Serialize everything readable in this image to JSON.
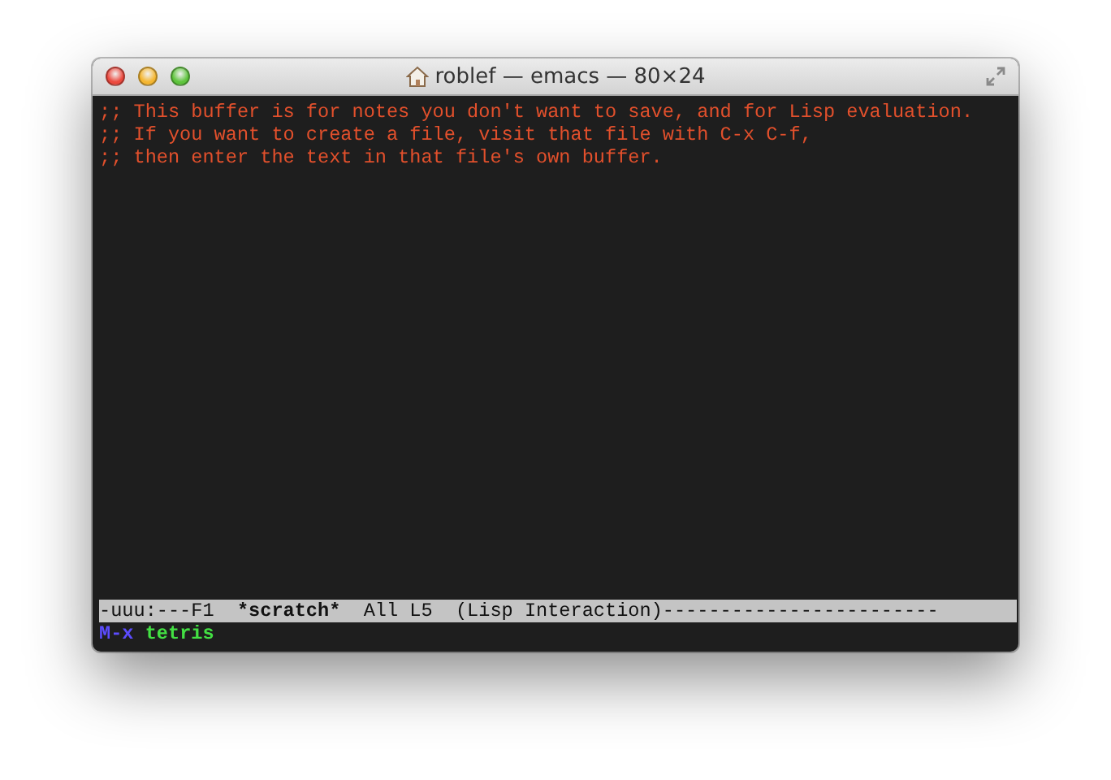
{
  "window": {
    "title": "roblef — emacs — 80×24"
  },
  "buffer_lines": [
    ";; This buffer is for notes you don't want to save, and for Lisp evaluation.",
    ";; If you want to create a file, visit that file with C-x C-f,",
    ";; then enter the text in that file's own buffer."
  ],
  "mode_line": [
    {
      "text": "-uuu:---F1",
      "bold": false
    },
    {
      "text": "*scratch*",
      "bold": true
    },
    {
      "text": "All L5",
      "bold": false
    },
    {
      "text": "(Lisp Interaction)------------------------",
      "bold": false
    }
  ],
  "minibuffer": {
    "prompt": "M-x",
    "input": "tetris"
  }
}
